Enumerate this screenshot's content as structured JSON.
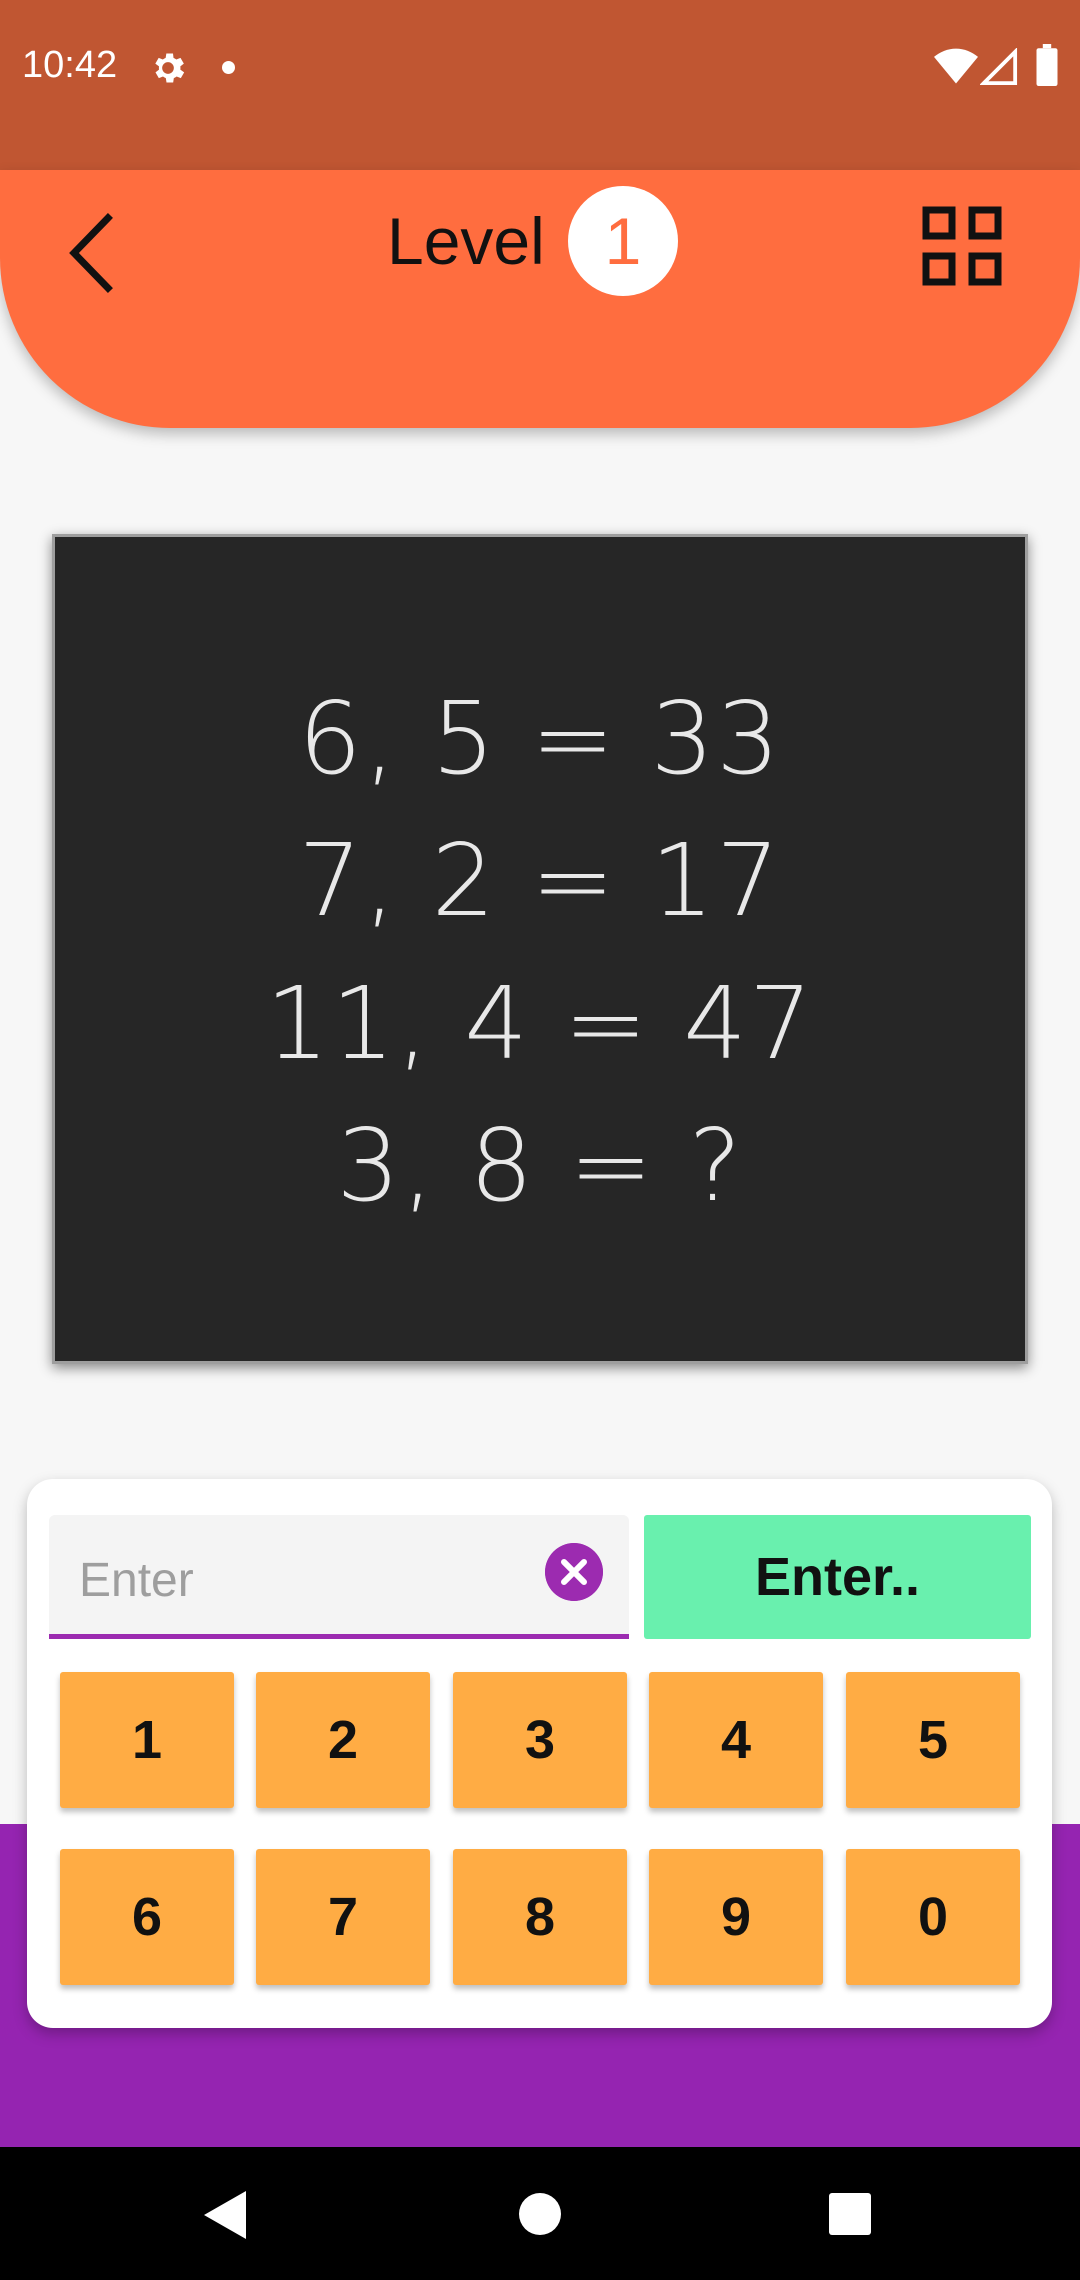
{
  "status_bar": {
    "time": "10:42",
    "icons": [
      "settings-icon",
      "notification-dot-icon",
      "wifi-icon",
      "cell-signal-icon",
      "battery-icon"
    ]
  },
  "header": {
    "title": "Level",
    "level_number": "1",
    "icons": [
      "back-arrow-icon",
      "grid-icon"
    ],
    "background_color": "#ff6d3f"
  },
  "puzzle": {
    "equations": [
      "6, 5 = 33",
      "7, 2 = 17",
      "11, 4 = 47",
      "3, 8 = ?"
    ]
  },
  "answer": {
    "value": "",
    "placeholder": "Enter",
    "clear_icon": "clear-x-icon",
    "enter_label": "Enter.."
  },
  "keypad": {
    "row1": [
      "1",
      "2",
      "3",
      "4",
      "5"
    ],
    "row2": [
      "6",
      "7",
      "8",
      "9",
      "0"
    ]
  },
  "colors": {
    "status_bar": "#c05632",
    "accent_purple": "#9c2bb0",
    "enter_button": "#69f0ae",
    "key": "#ffac44"
  },
  "nav_bar": {
    "icons": [
      "nav-back-icon",
      "nav-home-icon",
      "nav-recents-icon"
    ]
  }
}
